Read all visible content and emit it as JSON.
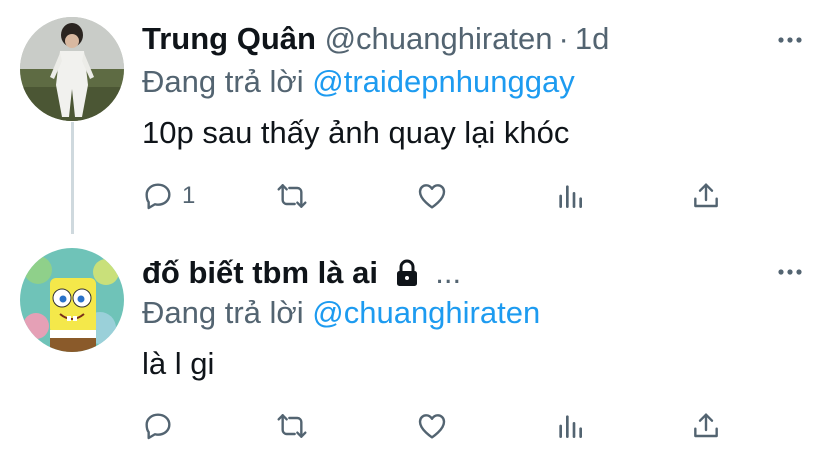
{
  "tweets": [
    {
      "name": "Trung Quân",
      "handle": "@chuanghiraten",
      "separator": "·",
      "time": "1d",
      "replying_prefix": "Đang trả lời",
      "replying_to": "@traidepnhunggay",
      "text": "10p sau thấy ảnh quay lại khóc",
      "reply_count": "1",
      "avatar": "photo-of-person-in-white-outfit-on-field"
    },
    {
      "name": "đố biết tbm là ai",
      "protected_icon": "lock-icon",
      "ellipsis": "...",
      "replying_prefix": "Đang trả lời",
      "replying_to": "@chuanghiraten",
      "text": "là l gi",
      "avatar": "spongebob-cartoon"
    }
  ],
  "icons": [
    "reply-icon",
    "retweet-icon",
    "like-icon",
    "analytics-icon",
    "share-icon",
    "more-icon"
  ],
  "colors": {
    "accent": "#1d9bf0",
    "secondary_text": "#536471",
    "thread_line": "#cfd9de"
  }
}
